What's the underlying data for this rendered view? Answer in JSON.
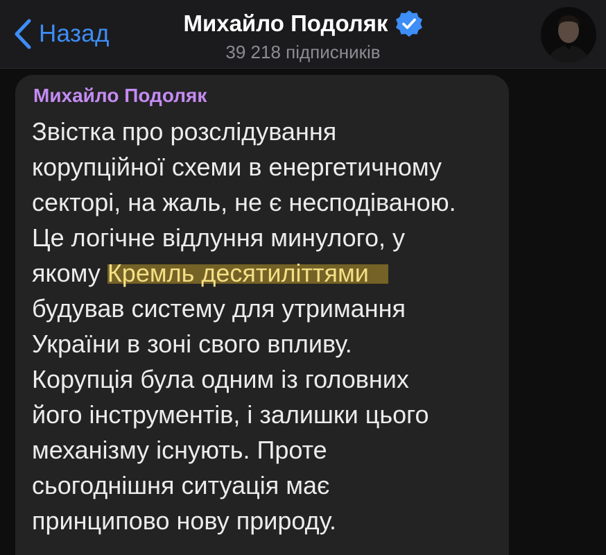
{
  "header": {
    "back_label": "Назад",
    "title": "Михайло Подоляк",
    "subscribers": "39 218 підписників",
    "verified_color": "#3d8ef7"
  },
  "post": {
    "sender": "Михайло Подоляк",
    "lines": [
      "Звістка про розслідування",
      "корупційної схеми в енергетичному",
      "секторі, на жаль, не є несподіваною.",
      "Це логічне відлуння минулого, у",
      "якому ",
      "будував систему для утримання",
      "України в зоні свого впливу.",
      "Корупція була одним із головних",
      "його інструментів, і залишки цього",
      "механізму існують. Проте",
      "сьогоднішня ситуація має",
      "принципово нову природу."
    ],
    "highlighted_text": "Кремль десятиліттями",
    "highlight_color": "#b79628"
  }
}
